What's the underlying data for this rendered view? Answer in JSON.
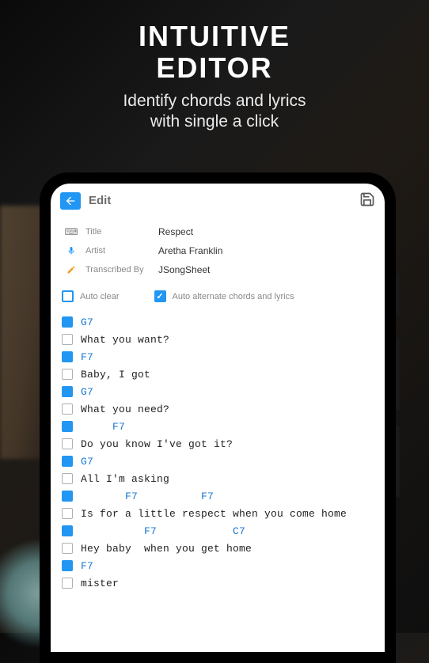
{
  "heading": {
    "title_line1": "INTUITIVE",
    "title_line2": "EDITOR",
    "subtitle_line1": "Identify chords and lyrics",
    "subtitle_line2": "with single a click"
  },
  "editor": {
    "topbar_title": "Edit",
    "meta": {
      "title_label": "Title",
      "title_value": "Respect",
      "artist_label": "Artist",
      "artist_value": "Aretha Franklin",
      "transcribed_label": "Transcribed By",
      "transcribed_value": "JSongSheet"
    },
    "options": {
      "auto_clear_label": "Auto clear",
      "auto_clear_checked": false,
      "auto_alternate_label": "Auto alternate chords and lyrics",
      "auto_alternate_checked": true
    },
    "lines": [
      {
        "filled": true,
        "type": "chord",
        "text": "G7"
      },
      {
        "filled": false,
        "type": "lyric",
        "text": "What you want?"
      },
      {
        "filled": true,
        "type": "chord",
        "text": "F7"
      },
      {
        "filled": false,
        "type": "lyric",
        "text": "Baby, I got"
      },
      {
        "filled": true,
        "type": "chord",
        "text": "G7"
      },
      {
        "filled": false,
        "type": "lyric",
        "text": "What you need?"
      },
      {
        "filled": true,
        "type": "chord",
        "text": "     F7"
      },
      {
        "filled": false,
        "type": "lyric",
        "text": "Do you know I've got it?"
      },
      {
        "filled": true,
        "type": "chord",
        "text": "G7"
      },
      {
        "filled": false,
        "type": "lyric",
        "text": "All I'm asking"
      },
      {
        "filled": true,
        "type": "chord",
        "text": "       F7          F7"
      },
      {
        "filled": false,
        "type": "lyric",
        "text": "Is for a little respect when you come home"
      },
      {
        "filled": true,
        "type": "chord",
        "text": "          F7            C7"
      },
      {
        "filled": false,
        "type": "lyric",
        "text": "Hey baby  when you get home"
      },
      {
        "filled": true,
        "type": "chord",
        "text": "F7"
      },
      {
        "filled": false,
        "type": "lyric",
        "text": "mister"
      }
    ]
  }
}
